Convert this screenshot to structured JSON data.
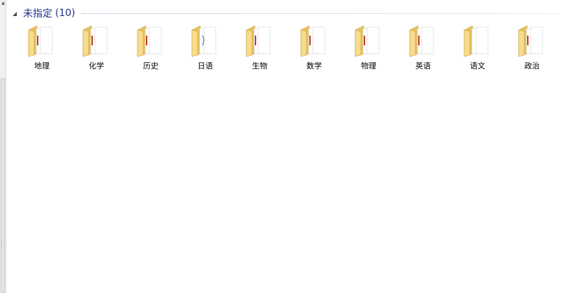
{
  "group": {
    "title": "未指定",
    "count": "(10)"
  },
  "folders": [
    {
      "label": "地理",
      "icon": "folder-icon"
    },
    {
      "label": "化学",
      "icon": "folder-icon"
    },
    {
      "label": "历史",
      "icon": "folder-icon"
    },
    {
      "label": "日语",
      "icon": "folder-icon"
    },
    {
      "label": "生物",
      "icon": "folder-icon"
    },
    {
      "label": "数学",
      "icon": "folder-icon"
    },
    {
      "label": "物理",
      "icon": "folder-icon"
    },
    {
      "label": "英语",
      "icon": "folder-icon"
    },
    {
      "label": "语文",
      "icon": "folder-icon"
    },
    {
      "label": "政治",
      "icon": "folder-icon"
    }
  ],
  "colors": {
    "group_title": "#1e3287",
    "folder_body": "#f4d67e",
    "folder_back": "#e9c25e",
    "paper": "#ffffff"
  }
}
